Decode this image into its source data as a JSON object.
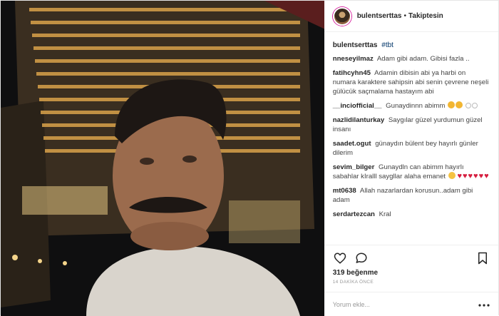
{
  "post": {
    "username": "bulentserttas",
    "separator": "•",
    "follow_status": "Takiptesin",
    "caption_user": "bulentserttas",
    "caption_tag": "#tbt",
    "comments": [
      {
        "user": "nneseyilmaz",
        "text": "Adam gibi adam. Gibisi fazla .."
      },
      {
        "user": "fatihcyhn45",
        "text": "Adamin dibisin abi ya harbi on numara karaktere sahipsin abi senin çevrene neşeli gülücük saçmalama hastayım abi"
      },
      {
        "user": "__inciofficial__",
        "text": "Gunaydinnn abimm"
      },
      {
        "user": "nazlidilanturkay",
        "text": "Saygılar güzel yurdumun güzel insanı"
      },
      {
        "user": "saadet.ogut",
        "text": "günaydın bülent bey hayırlı günler dilerim"
      },
      {
        "user": "sevim_bilger",
        "text": "Gunaydln can abimm hayırlı sabahlar kIralll saygllar alaha emanet"
      },
      {
        "user": "mt0638",
        "text": "Allah nazarlardan korusun..adam gibi adam"
      },
      {
        "user": "serdartezcan",
        "text": "Kral"
      }
    ],
    "likes": "319 beğenme",
    "time_ago": "14 DAKİKA ÖNCE",
    "add_comment_placeholder": "Yorum ekle...",
    "icons": {
      "like": "heart-outline-icon",
      "comment": "speech-bubble-icon",
      "save": "bookmark-icon",
      "more": "more-dots-icon"
    },
    "colors": {
      "text": "#262626",
      "muted": "#999999",
      "hashtag": "#003569",
      "heart": "#d61e3f"
    }
  }
}
